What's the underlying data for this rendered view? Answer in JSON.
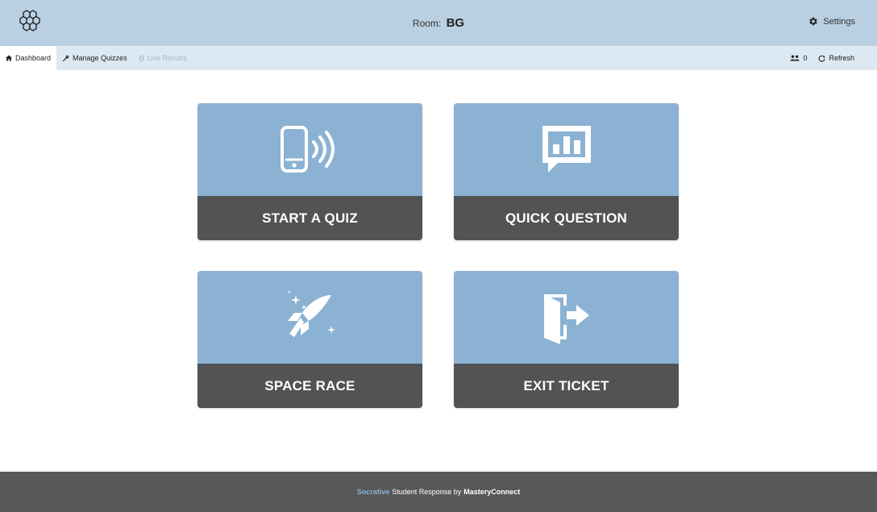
{
  "header": {
    "logo_icon": "hexagon-cluster-icon",
    "room_label": "Room:",
    "room_code": "BG",
    "settings_icon": "gear-icon",
    "settings_label": "Settings"
  },
  "nav": {
    "tabs": [
      {
        "label": "Dashboard",
        "icon": "home-icon",
        "state": "active"
      },
      {
        "label": "Manage Quizzes",
        "icon": "wrench-icon",
        "state": "normal"
      },
      {
        "label": "Live Results",
        "icon": "gauge-icon",
        "state": "disabled"
      }
    ],
    "student_count": "0",
    "students_icon": "users-icon",
    "refresh_icon": "refresh-icon",
    "refresh_label": "Refresh"
  },
  "tiles": [
    {
      "label": "START A QUIZ",
      "icon": "phone-signal-icon"
    },
    {
      "label": "QUICK QUESTION",
      "icon": "chart-bubble-icon"
    },
    {
      "label": "SPACE RACE",
      "icon": "rocket-icon"
    },
    {
      "label": "EXIT TICKET",
      "icon": "exit-door-icon"
    }
  ],
  "footer": {
    "brand": "Socrative",
    "middle": "Student Response by",
    "company": "MasteryConnect"
  },
  "colors": {
    "header_bg": "#b9d0e2",
    "nav_bg": "#dce8f2",
    "tile_top": "#8bb2d3",
    "tile_bottom": "#535353",
    "footer_bg": "#585858",
    "brand_accent": "#8bb2d3"
  }
}
